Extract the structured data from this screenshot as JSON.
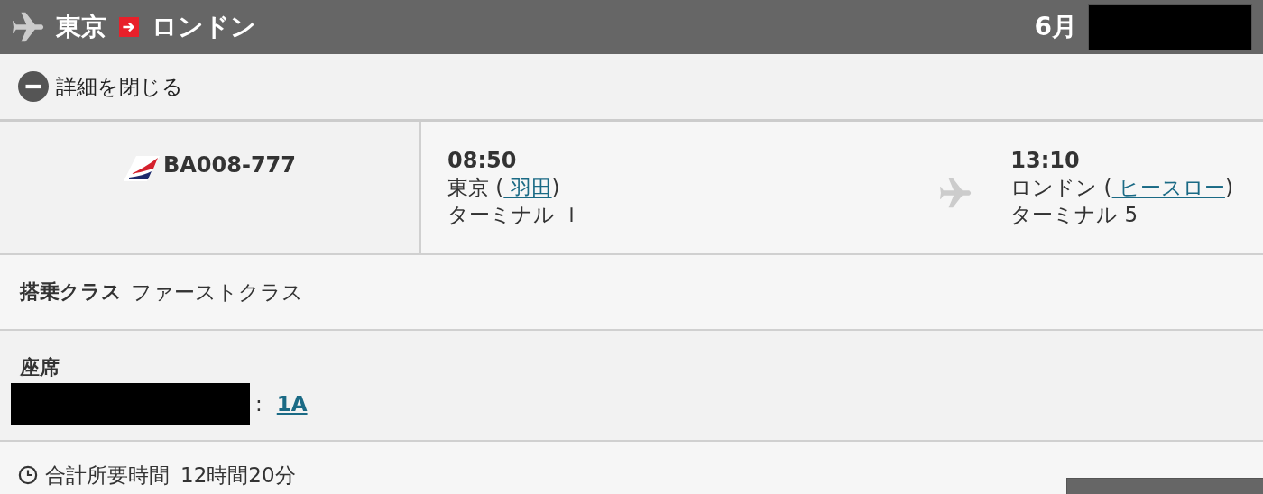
{
  "header": {
    "origin": "東京",
    "destination": "ロンドン",
    "month": "6月",
    "date_redacted": true
  },
  "toggle": {
    "label": "詳細を閉じる",
    "expanded": true
  },
  "flight": {
    "number": "BA008-777",
    "departure": {
      "time": "08:50",
      "city": "東京 (",
      "airport": " 羽田",
      "close": ")",
      "terminal": "ターミナル Ｉ"
    },
    "arrival": {
      "time": "13:10",
      "city": "ロンドン (",
      "airport": " ヒースロー",
      "close": ")",
      "terminal": "ターミナル 5"
    }
  },
  "cabin": {
    "label": "搭乗クラス",
    "value": "ファーストクラス"
  },
  "seat": {
    "label": "座席",
    "passenger_redacted": true,
    "separator": ":",
    "value": "1A"
  },
  "duration": {
    "label": "合計所要時間",
    "value": "12時間20分"
  }
}
